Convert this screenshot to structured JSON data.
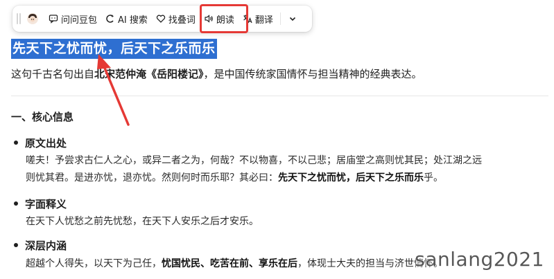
{
  "toolbar": {
    "ask_label": "问问豆包",
    "ai_search_label": "AI 搜索",
    "find_label": "找叠词",
    "read_label": "朗读",
    "translate_label": "翻译"
  },
  "highlight_color": "#e53935",
  "selection_color": "#2e6fd1",
  "content": {
    "headline": "先天下之忧而忧，后天下之乐而乐",
    "intro_pre": "这句千古名句出自",
    "intro_bold": "北宋范仲淹《岳阳楼记》",
    "intro_post": "，是中国传统家国情怀与担当精神的经典表达。",
    "section_title": "一、核心信息",
    "bullets": [
      {
        "title": "原文出处",
        "line1": "嗟夫！予尝求古仁人之心，或异二者之为，何哉？不以物喜，不以己悲；居庙堂之高则忧其民；处江湖之远",
        "line2_pre": "则忧其君。是进亦忧，退亦忧。然则何时而乐耶？其必曰：",
        "line2_bold": "先天下之忧而忧，后天下之乐而乐",
        "line2_post": "乎。"
      },
      {
        "title": "字面释义",
        "line1": "在天下人忧愁之前先忧愁，在天下人安乐之后才安乐。"
      },
      {
        "title": "深层内涵",
        "line1_pre": "超越个人得失，以天下为己任，",
        "line1_bold": "忧国忧民、吃苦在前、享乐在后",
        "line1_post": "，体现士大夫的担当与济世情怀。"
      }
    ]
  },
  "watermark": "sanlang2021"
}
